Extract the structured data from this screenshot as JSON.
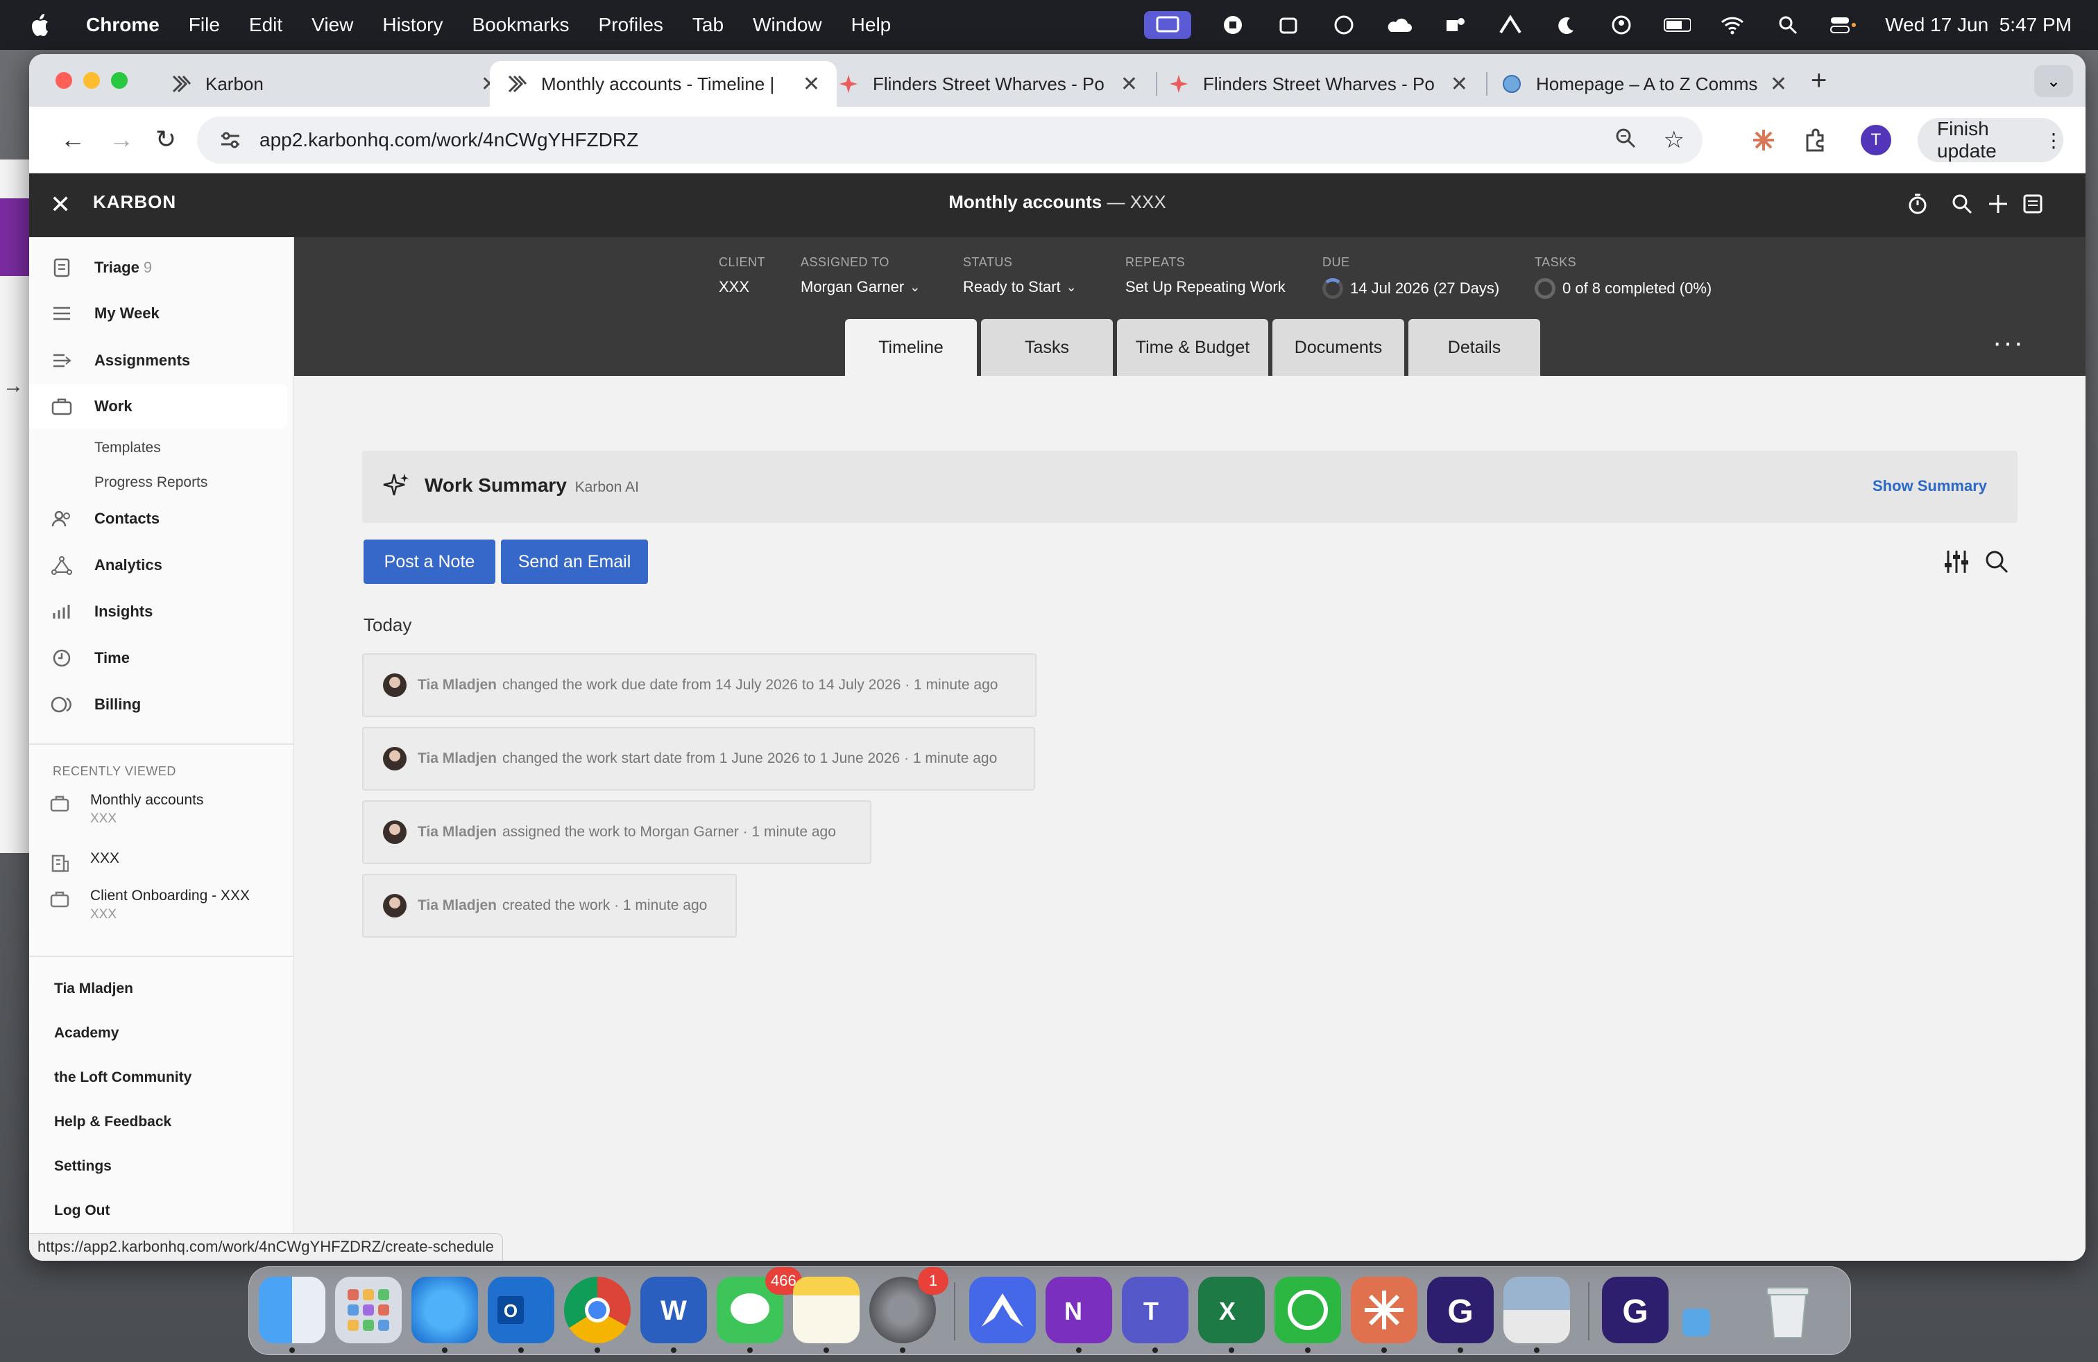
{
  "menubar": {
    "app_name": "Chrome",
    "items": [
      "File",
      "Edit",
      "View",
      "History",
      "Bookmarks",
      "Profiles",
      "Tab",
      "Window",
      "Help"
    ],
    "datetime": "Wed 17 Jun  5:47 PM"
  },
  "browser": {
    "tabs": [
      {
        "title": "Karbon",
        "active": false
      },
      {
        "title": "Monthly accounts - Timeline |",
        "active": true
      },
      {
        "title": "Flinders Street Wharves - Po",
        "active": false
      },
      {
        "title": "Flinders Street Wharves - Po",
        "active": false
      },
      {
        "title": "Homepage – A to Z Comms &",
        "active": false
      }
    ],
    "url": "app2.karbonhq.com/work/4nCWgYHFZDRZ",
    "profile_initial": "T",
    "finish_update_label": "Finish update",
    "status_url": "https://app2.karbonhq.com/work/4nCWgYHFZDRZ/create-schedule"
  },
  "app": {
    "brand": "KARBON",
    "page_title": "Monthly accounts",
    "page_title_sep": " — ",
    "page_title_client": "XXX"
  },
  "sidebar": {
    "items": [
      {
        "label": "Triage",
        "count": "9"
      },
      {
        "label": "My Week"
      },
      {
        "label": "Assignments"
      },
      {
        "label": "Work"
      },
      {
        "label": "Contacts"
      },
      {
        "label": "Analytics"
      },
      {
        "label": "Insights"
      },
      {
        "label": "Time"
      },
      {
        "label": "Billing"
      }
    ],
    "sub_items": [
      "Templates",
      "Progress Reports"
    ],
    "recently_viewed_heading": "RECENTLY VIEWED",
    "recent": [
      {
        "title": "Monthly accounts",
        "subtitle": "XXX"
      },
      {
        "title": "XXX",
        "subtitle": ""
      },
      {
        "title": "Client Onboarding - XXX",
        "subtitle": "XXX"
      }
    ],
    "bottom_links": [
      "Tia Mladjen",
      "Academy",
      "the Loft Community",
      "Help & Feedback",
      "Settings",
      "Log Out"
    ]
  },
  "work": {
    "meta": {
      "client": {
        "label": "CLIENT",
        "value": "XXX"
      },
      "assigned": {
        "label": "ASSIGNED TO",
        "value": "Morgan Garner"
      },
      "status": {
        "label": "STATUS",
        "value": "Ready to Start"
      },
      "repeats": {
        "label": "REPEATS",
        "value": "Set Up Repeating Work"
      },
      "due": {
        "label": "DUE",
        "value": "14 Jul 2026 (27 Days)"
      },
      "tasks": {
        "label": "TASKS",
        "value": "0 of 8 completed (0%)"
      }
    },
    "tabs": [
      "Timeline",
      "Tasks",
      "Time & Budget",
      "Documents",
      "Details"
    ],
    "active_tab": "Timeline"
  },
  "summary": {
    "title": "Work Summary",
    "subtitle": "Karbon AI",
    "action": "Show Summary"
  },
  "actions": {
    "post_note": "Post a Note",
    "send_email": "Send an Email"
  },
  "timeline": {
    "group_label": "Today",
    "events": [
      {
        "who": "Tia Mladjen",
        "text": "changed the work due date from 14 July 2026 to 14 July 2026 ·  1 minute ago"
      },
      {
        "who": "Tia Mladjen",
        "text": "changed the work start date from 1 June 2026 to 1 June 2026 ·  1 minute ago"
      },
      {
        "who": "Tia Mladjen",
        "text": "assigned the work to Morgan Garner ·  1 minute ago"
      },
      {
        "who": "Tia Mladjen",
        "text": "created the work ·  1 minute ago"
      }
    ]
  },
  "dock": {
    "messages_badge": "466",
    "settings_badge": "1"
  },
  "colors": {
    "accent_blue": "#3668c9",
    "header_dark": "#2b2b2b",
    "work_header": "#3a3a3a"
  }
}
